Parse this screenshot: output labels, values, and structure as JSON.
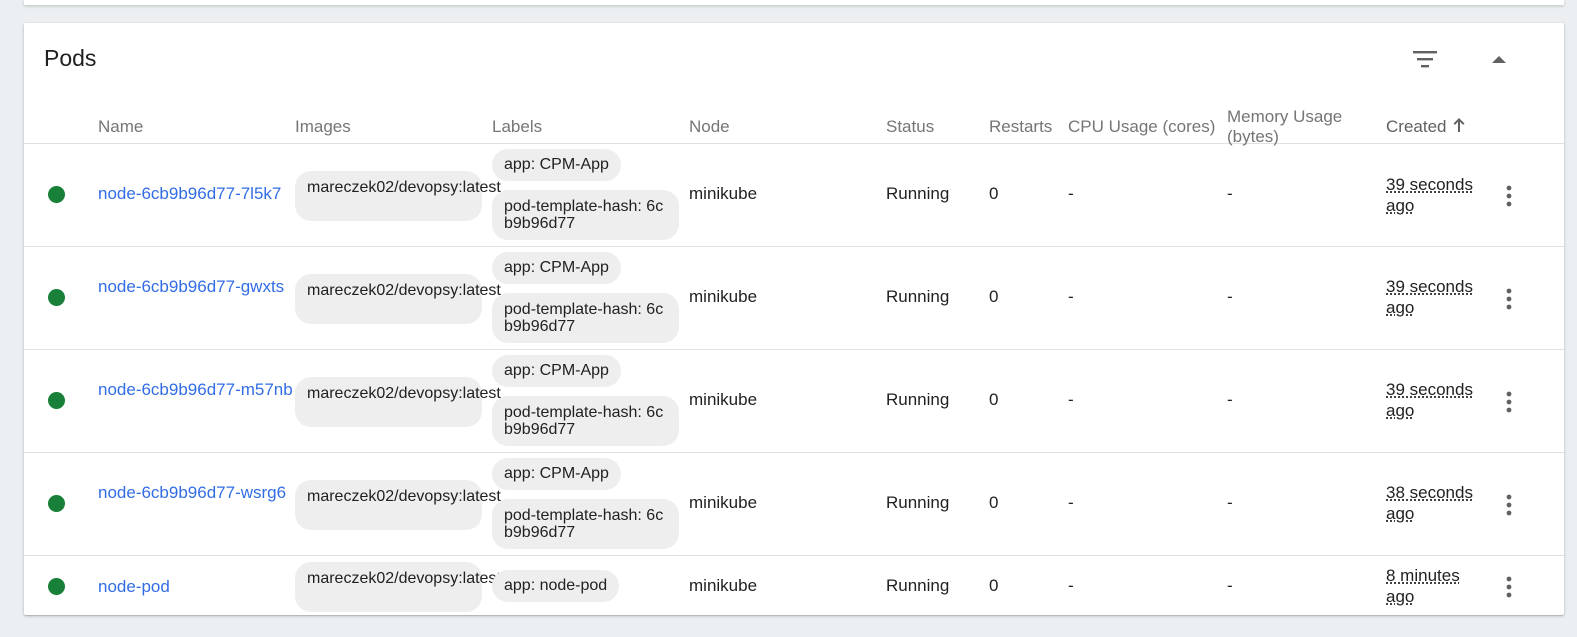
{
  "card": {
    "title": "Pods",
    "filter_icon": "filter-list-icon",
    "collapse_icon": "expand-less-icon"
  },
  "columns": {
    "name": "Name",
    "images": "Images",
    "labels": "Labels",
    "node": "Node",
    "status": "Status",
    "restarts": "Restarts",
    "cpu": "CPU Usage (cores)",
    "memory_line1": "Memory Usage",
    "memory_line2": "(bytes)",
    "created": "Created",
    "created_sort_icon": "arrow-upward-icon"
  },
  "colors": {
    "status_running": "#188038",
    "link": "#326de6",
    "chip_bg": "#eeeeee"
  },
  "pods": [
    {
      "name": "node-6cb9b96d77-7l5k7",
      "image": "mareczek02/devopsy:latest",
      "label_app": "app: CPM-App",
      "label_hash": "pod-template-hash: 6cb9b96d77",
      "node": "minikube",
      "status": "Running",
      "restarts": "0",
      "cpu": "-",
      "memory": "-",
      "created": "39 seconds ago"
    },
    {
      "name": "node-6cb9b96d77-gwxts",
      "image": "mareczek02/devopsy:latest",
      "label_app": "app: CPM-App",
      "label_hash": "pod-template-hash: 6cb9b96d77",
      "node": "minikube",
      "status": "Running",
      "restarts": "0",
      "cpu": "-",
      "memory": "-",
      "created": "39 seconds ago"
    },
    {
      "name": "node-6cb9b96d77-m57nb",
      "image": "mareczek02/devopsy:latest",
      "label_app": "app: CPM-App",
      "label_hash": "pod-template-hash: 6cb9b96d77",
      "node": "minikube",
      "status": "Running",
      "restarts": "0",
      "cpu": "-",
      "memory": "-",
      "created": "39 seconds ago"
    },
    {
      "name": "node-6cb9b96d77-wsrg6",
      "image": "mareczek02/devopsy:latest",
      "label_app": "app: CPM-App",
      "label_hash": "pod-template-hash: 6cb9b96d77",
      "node": "minikube",
      "status": "Running",
      "restarts": "0",
      "cpu": "-",
      "memory": "-",
      "created": "38 seconds ago"
    },
    {
      "name": "node-pod",
      "image": "mareczek02/devopsy:latest",
      "label_app": "app: node-pod",
      "node": "minikube",
      "status": "Running",
      "restarts": "0",
      "cpu": "-",
      "memory": "-",
      "created": "8 minutes ago"
    }
  ]
}
